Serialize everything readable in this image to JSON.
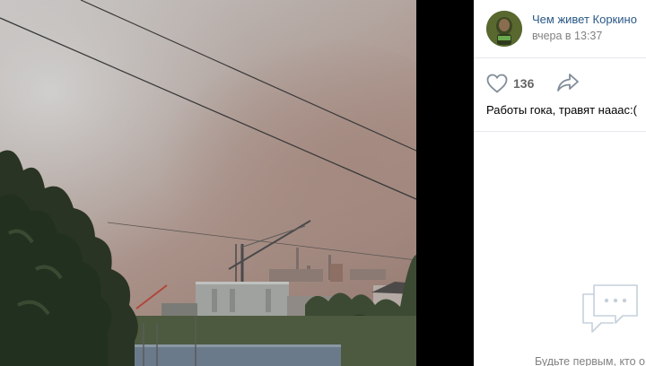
{
  "post": {
    "author_name": "Чем живет Коркино",
    "time": "вчера в 13:37",
    "like_count": "136",
    "text": "Работы гока, травят нааас:("
  },
  "comments": {
    "empty_hint": "Будьте первым, кто о"
  },
  "icons": {
    "like": "heart-icon",
    "share": "share-arrow-icon",
    "comments": "comment-bubbles-icon"
  },
  "colors": {
    "link": "#2a5885",
    "meta": "#828282",
    "icon": "#818c99",
    "panel_bg": "#ffffff",
    "viewer_bg": "#000000"
  }
}
